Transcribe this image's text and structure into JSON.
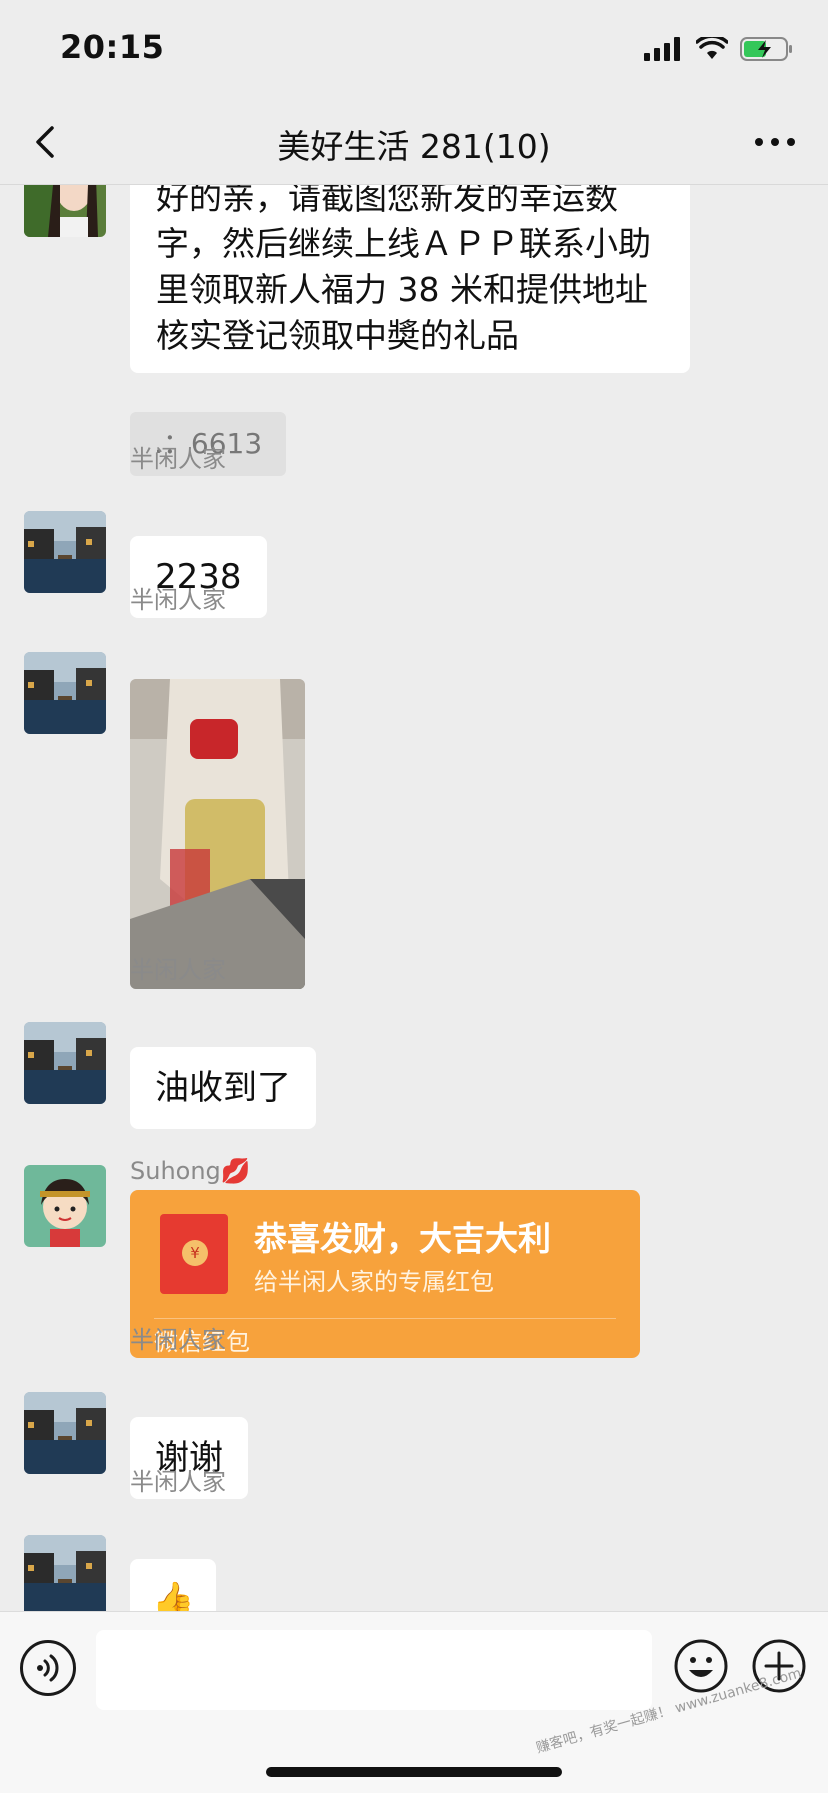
{
  "status": {
    "time": "20:15"
  },
  "nav": {
    "title": "美好生活 281(10)"
  },
  "messages": {
    "m1": {
      "text": "好的亲，请截图您新发的幸运数字，然后继续上线ＡＰＰ联系小助里领取新人福力 38 米和提供地址核实登记领取中奬的礼品",
      "quote": ".：6613"
    },
    "m2": {
      "sender": "半闲人家",
      "text": "2238"
    },
    "m3": {
      "sender": "半闲人家"
    },
    "m4": {
      "sender": "半闲人家",
      "text": "油收到了"
    },
    "m5": {
      "sender": "Suhong💋",
      "red_packet": {
        "title": "恭喜发财，大吉大利",
        "subtitle": "给半闲人家的专属红包",
        "footer": "微信红包"
      }
    },
    "m6": {
      "sender": "半闲人家",
      "text": "谢谢"
    },
    "m7": {
      "sender": "半闲人家",
      "emoji": "👍"
    }
  },
  "input": {
    "value": "",
    "placeholder": ""
  },
  "watermark": "赚客吧，有奖一起赚！ www.zuanke8.com",
  "colors": {
    "background": "#ededed",
    "bubble": "#ffffff",
    "red_packet": "#f7a23c",
    "accent_text": "#111111"
  }
}
